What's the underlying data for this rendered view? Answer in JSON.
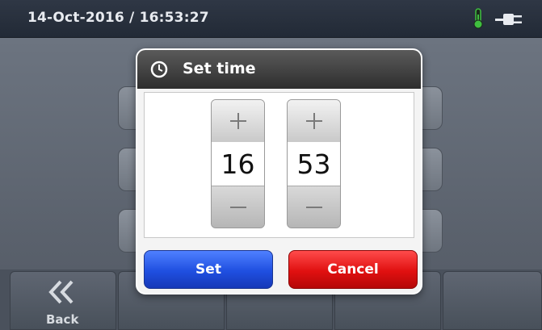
{
  "status_bar": {
    "datetime": "14-Oct-2016 / 16:53:27",
    "icons": [
      "thermometer-icon",
      "power-plug-icon"
    ]
  },
  "dialog": {
    "title": "Set time",
    "title_icon": "clock-icon",
    "hour": {
      "value": "16",
      "increment_symbol": "+",
      "decrement_symbol": "−"
    },
    "minute": {
      "value": "53",
      "increment_symbol": "+",
      "decrement_symbol": "−"
    },
    "set_label": "Set",
    "cancel_label": "Cancel"
  },
  "bottom_nav": {
    "back_label": "Back",
    "back_icon": "double-chevron-left-icon"
  },
  "colors": {
    "set_button": "#2456e8",
    "cancel_button": "#e01010",
    "thermometer": "#3fbf3f"
  }
}
